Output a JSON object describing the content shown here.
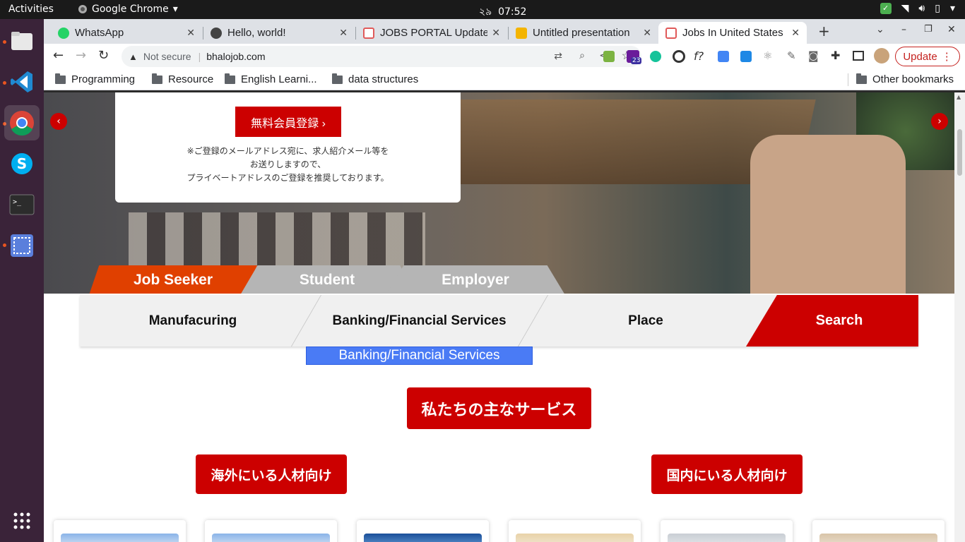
{
  "topbar": {
    "activities": "Activities",
    "app_name": "Google Chrome",
    "date": "২৯",
    "time": "07:52"
  },
  "tabs": [
    {
      "title": "WhatsApp",
      "favicon_color": "#25d366"
    },
    {
      "title": "Hello, world!",
      "favicon_color": "#444444"
    },
    {
      "title": "JOBS PORTAL Update",
      "favicon_color": "#e05a5a"
    },
    {
      "title": "Untitled presentation",
      "favicon_color": "#f4b400"
    },
    {
      "title": "Jobs In United States",
      "favicon_color": "#e05a5a"
    }
  ],
  "address": {
    "security": "Not secure",
    "url": "bhalojob.com"
  },
  "toolbar": {
    "update_label": "Update",
    "extension_badge": "23"
  },
  "bookmarks": {
    "items": [
      "Programming",
      "Resource",
      "English Learni...",
      "data structures"
    ],
    "other": "Other bookmarks"
  },
  "page": {
    "register_button": "無料会員登録",
    "register_note": [
      "※ご登録のメールアドレス宛に、求人紹介メール等を",
      "お送りしますので、",
      "プライベートアドレスのご登録を推奨しております。"
    ],
    "user_tabs": [
      "Job Seeker",
      "Student",
      "Employer"
    ],
    "search_fields": [
      "Manufacuring",
      "Banking/Financial Services",
      "Place"
    ],
    "search_button": "Search",
    "dropdown_option": "Banking/Financial Services",
    "services_heading": "私たちの主なサービス",
    "overseas_label": "海外にいる人材向け",
    "domestic_label": "国内にいる人材向け"
  },
  "colors": {
    "brand_red": "#cc0000",
    "tab_orange": "#e04000",
    "dropdown_blue": "#4a7bf5"
  }
}
